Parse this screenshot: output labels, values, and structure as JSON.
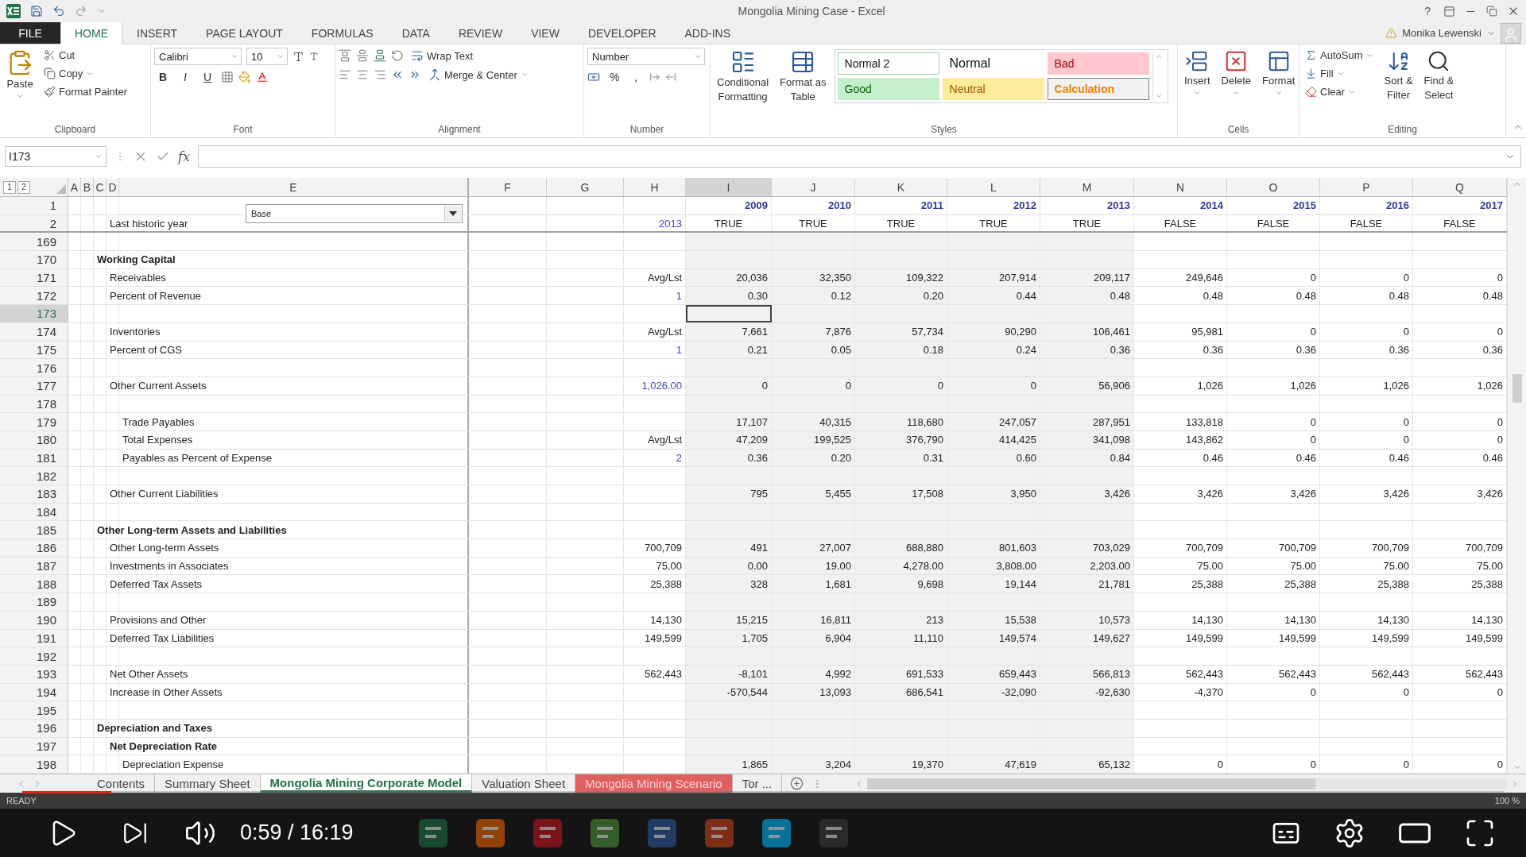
{
  "window": {
    "title": "Mongolia Mining Case - Excel",
    "help": "?",
    "user": "Monika Lewenski"
  },
  "ribbon_tabs": [
    {
      "label": "FILE",
      "kind": "file",
      "selected": false
    },
    {
      "label": "HOME",
      "kind": "tab",
      "selected": true
    },
    {
      "label": "INSERT",
      "kind": "tab",
      "selected": false
    },
    {
      "label": "PAGE LAYOUT",
      "kind": "tab",
      "selected": false
    },
    {
      "label": "FORMULAS",
      "kind": "tab",
      "selected": false
    },
    {
      "label": "DATA",
      "kind": "tab",
      "selected": false
    },
    {
      "label": "REVIEW",
      "kind": "tab",
      "selected": false
    },
    {
      "label": "VIEW",
      "kind": "tab",
      "selected": false
    },
    {
      "label": "DEVELOPER",
      "kind": "tab",
      "selected": false
    },
    {
      "label": "ADD-INS",
      "kind": "tab",
      "selected": false
    }
  ],
  "clipboard": {
    "paste": "Paste",
    "items": [
      "Cut",
      "Copy",
      "Format Painter"
    ],
    "label": "Clipboard"
  },
  "font": {
    "family": "Calibri",
    "size": "10",
    "styles": [
      "B",
      "I",
      "U"
    ],
    "label": "Font"
  },
  "alignment": {
    "wrap": "Wrap Text",
    "merge": "Merge & Center",
    "label": "Alignment"
  },
  "number": {
    "format": "Number",
    "symbols": [
      "%",
      ","
    ],
    "label": "Number"
  },
  "styles": {
    "conditional": [
      "Conditional",
      "Formatting"
    ],
    "format_table": [
      "Format as",
      "Table"
    ],
    "label": "Styles",
    "gallery": [
      {
        "label": "Normal 2",
        "kind": "normal2"
      },
      {
        "label": "Normal",
        "kind": "normal"
      },
      {
        "label": "Bad",
        "kind": "bad"
      },
      {
        "label": "Good",
        "kind": "good"
      },
      {
        "label": "Neutral",
        "kind": "neutral"
      },
      {
        "label": "Calculation",
        "kind": "calculation"
      }
    ]
  },
  "cells": {
    "buttons": [
      "Insert",
      "Delete",
      "Format"
    ],
    "label": "Cells"
  },
  "editing": {
    "items": [
      "AutoSum",
      "Fill",
      "Clear"
    ],
    "sort": [
      "Sort &",
      "Filter"
    ],
    "find": [
      "Find &",
      "Select"
    ],
    "label": "Editing"
  },
  "formula_bar": {
    "name_box": "I173",
    "fx": "fx"
  },
  "outline_levels": [
    "1",
    "2"
  ],
  "columns": [
    {
      "letter": "A",
      "selected": false,
      "shaded": false
    },
    {
      "letter": "B",
      "selected": false,
      "shaded": false
    },
    {
      "letter": "C",
      "selected": false,
      "shaded": false
    },
    {
      "letter": "D",
      "selected": false,
      "shaded": false
    },
    {
      "letter": "E",
      "selected": false,
      "shaded": false
    },
    {
      "letter": "F",
      "selected": false,
      "shaded": false
    },
    {
      "letter": "G",
      "selected": false,
      "shaded": false
    },
    {
      "letter": "H",
      "selected": false,
      "shaded": false
    },
    {
      "letter": "I",
      "selected": true,
      "shaded": true
    },
    {
      "letter": "J",
      "selected": false,
      "shaded": true
    },
    {
      "letter": "K",
      "selected": false,
      "shaded": true
    },
    {
      "letter": "L",
      "selected": false,
      "shaded": true
    },
    {
      "letter": "M",
      "selected": false,
      "shaded": true
    },
    {
      "letter": "N",
      "selected": false,
      "shaded": false
    },
    {
      "letter": "O",
      "selected": false,
      "shaded": false
    },
    {
      "letter": "P",
      "selected": false,
      "shaded": false
    },
    {
      "letter": "Q",
      "selected": false,
      "shaded": false
    }
  ],
  "dropdown": {
    "value": "Base"
  },
  "rows": [
    {
      "n": "1",
      "selected": false,
      "years": [
        "2009",
        "2010",
        "2011",
        "2012",
        "2013",
        "2014",
        "2015",
        "2016",
        "2017"
      ]
    },
    {
      "n": "2",
      "selected": false,
      "kind": "item",
      "label": "Last historic year",
      "input": "2013",
      "flags": [
        "TRUE",
        "TRUE",
        "TRUE",
        "TRUE",
        "TRUE",
        "FALSE",
        "FALSE",
        "FALSE",
        "FALSE"
      ]
    },
    {
      "n": "169",
      "selected": false
    },
    {
      "n": "170",
      "selected": false,
      "kind": "heading",
      "label": "Working Capital"
    },
    {
      "n": "171",
      "selected": false,
      "kind": "item",
      "label": "Receivables",
      "base_value": "Avg/Lst",
      "values": [
        "20,036",
        "32,350",
        "109,322",
        "207,914",
        "209,117",
        "249,646",
        "0",
        "0",
        "0"
      ]
    },
    {
      "n": "172",
      "selected": false,
      "kind": "item",
      "label": "Percent of Revenue",
      "input": "1",
      "values": [
        "0.30",
        "0.12",
        "0.20",
        "0.44",
        "0.48",
        "0.48",
        "0.48",
        "0.48",
        "0.48"
      ]
    },
    {
      "n": "173",
      "selected": true
    },
    {
      "n": "174",
      "selected": false,
      "kind": "item",
      "label": "Inventories",
      "base_value": "Avg/Lst",
      "values": [
        "7,661",
        "7,876",
        "57,734",
        "90,290",
        "106,461",
        "95,981",
        "0",
        "0",
        "0"
      ]
    },
    {
      "n": "175",
      "selected": false,
      "kind": "item",
      "label": "Percent of CGS",
      "input": "1",
      "values": [
        "0.21",
        "0.05",
        "0.18",
        "0.24",
        "0.36",
        "0.36",
        "0.36",
        "0.36",
        "0.36"
      ]
    },
    {
      "n": "176",
      "selected": false
    },
    {
      "n": "177",
      "selected": false,
      "kind": "item",
      "label": "Other Current Assets",
      "input": "1,026.00",
      "values": [
        "0",
        "0",
        "0",
        "0",
        "56,906",
        "1,026",
        "1,026",
        "1,026",
        "1,026"
      ]
    },
    {
      "n": "178",
      "selected": false
    },
    {
      "n": "179",
      "selected": false,
      "kind": "subitem",
      "label": "Trade Payables",
      "values": [
        "17,107",
        "40,315",
        "118,680",
        "247,057",
        "287,951",
        "133,818",
        "0",
        "0",
        "0"
      ]
    },
    {
      "n": "180",
      "selected": false,
      "kind": "subitem",
      "label": "Total Expenses",
      "base_value": "Avg/Lst",
      "values": [
        "47,209",
        "199,525",
        "376,790",
        "414,425",
        "341,098",
        "143,862",
        "0",
        "0",
        "0"
      ]
    },
    {
      "n": "181",
      "selected": false,
      "kind": "subitem",
      "label": "Payables as Percent of Expense",
      "input": "2",
      "values": [
        "0.36",
        "0.20",
        "0.31",
        "0.60",
        "0.84",
        "0.46",
        "0.46",
        "0.46",
        "0.46"
      ]
    },
    {
      "n": "182",
      "selected": false
    },
    {
      "n": "183",
      "selected": false,
      "kind": "item",
      "label": "Other Current Liabilities",
      "values": [
        "795",
        "5,455",
        "17,508",
        "3,950",
        "3,426",
        "3,426",
        "3,426",
        "3,426",
        "3,426"
      ]
    },
    {
      "n": "184",
      "selected": false
    },
    {
      "n": "185",
      "selected": false,
      "kind": "heading",
      "label": "Other Long-term Assets and Liabilities"
    },
    {
      "n": "186",
      "selected": false,
      "kind": "item",
      "label": "Other Long-term Assets",
      "base_value": "700,709",
      "values": [
        "491",
        "27,007",
        "688,880",
        "801,603",
        "703,029",
        "700,709",
        "700,709",
        "700,709",
        "700,709"
      ]
    },
    {
      "n": "187",
      "selected": false,
      "kind": "item",
      "label": "Investments in Associates",
      "base_value": "75.00",
      "values": [
        "0.00",
        "19.00",
        "4,278.00",
        "3,808.00",
        "2,203.00",
        "75.00",
        "75.00",
        "75.00",
        "75.00"
      ]
    },
    {
      "n": "188",
      "selected": false,
      "kind": "item",
      "label": "Deferred Tax Assets",
      "base_value": "25,388",
      "values": [
        "328",
        "1,681",
        "9,698",
        "19,144",
        "21,781",
        "25,388",
        "25,388",
        "25,388",
        "25,388"
      ]
    },
    {
      "n": "189",
      "selected": false
    },
    {
      "n": "190",
      "selected": false,
      "kind": "item",
      "label": "Provisions and Other",
      "base_value": "14,130",
      "values": [
        "15,215",
        "16,811",
        "213",
        "15,538",
        "10,573",
        "14,130",
        "14,130",
        "14,130",
        "14,130"
      ]
    },
    {
      "n": "191",
      "selected": false,
      "kind": "item",
      "label": "Deferred Tax Liabilities",
      "base_value": "149,599",
      "values": [
        "1,705",
        "6,904",
        "11,110",
        "149,574",
        "149,627",
        "149,599",
        "149,599",
        "149,599",
        "149,599"
      ]
    },
    {
      "n": "192",
      "selected": false
    },
    {
      "n": "193",
      "selected": false,
      "kind": "item",
      "label": "Net Other Assets",
      "base_value": "562,443",
      "values": [
        "-8,101",
        "4,992",
        "691,533",
        "659,443",
        "566,813",
        "562,443",
        "562,443",
        "562,443",
        "562,443"
      ]
    },
    {
      "n": "194",
      "selected": false,
      "kind": "item",
      "label": "Increase in Other Assets",
      "values": [
        "-570,544",
        "13,093",
        "686,541",
        "-32,090",
        "-92,630",
        "-4,370",
        "0",
        "0",
        "0"
      ]
    },
    {
      "n": "195",
      "selected": false
    },
    {
      "n": "196",
      "selected": false,
      "kind": "heading",
      "label": "Depreciation and Taxes"
    },
    {
      "n": "197",
      "selected": false,
      "kind": "subheading",
      "label": "Net Depreciation Rate"
    },
    {
      "n": "198",
      "selected": false,
      "kind": "subitem",
      "label": "Depreciation Expense",
      "values": [
        "1,865",
        "3,204",
        "19,370",
        "47,619",
        "65,132",
        "0",
        "0",
        "0",
        "0"
      ]
    }
  ],
  "sheet_tabs": [
    {
      "label": "Contents",
      "selected": false
    },
    {
      "label": "Summary Sheet",
      "selected": false
    },
    {
      "label": "Mongolia Mining Corporate Model",
      "selected": true
    },
    {
      "label": "Valuation Sheet",
      "selected": false
    },
    {
      "label": "Mongolia Mining Scenario",
      "selected": false,
      "color": "#e06060"
    },
    {
      "label": "Tor ...",
      "selected": false
    }
  ],
  "status_bar": {
    "mode": "READY",
    "zoom": "100 %"
  },
  "video": {
    "time": "0:59 / 16:19",
    "level": 0.06
  }
}
